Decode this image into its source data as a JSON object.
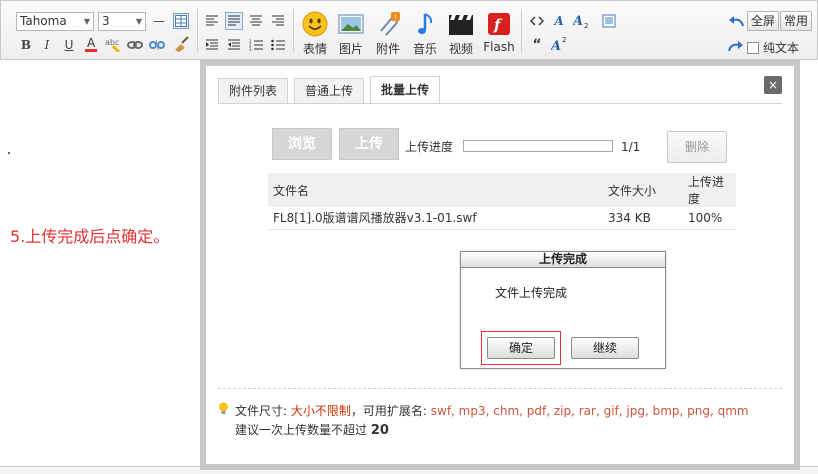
{
  "toolbar": {
    "font_family": "Tahoma",
    "font_size": "3",
    "big_tools": {
      "emoticon": "表情",
      "image": "图片",
      "attachment": "附件",
      "music": "音乐",
      "video": "视频",
      "flash": "Flash"
    },
    "fullscreen_label": "全屏",
    "common_label": "常用",
    "plain_text_label": "纯文本"
  },
  "editor": {
    "instruction": "5.上传完成后点确定。"
  },
  "dialog": {
    "tabs": [
      "附件列表",
      "普通上传",
      "批量上传"
    ],
    "active_tab": "批量上传",
    "close_label": "×",
    "browse_label": "浏览",
    "upload_label": "上传",
    "progress_label": "上传进度",
    "progress_fraction": 0,
    "progress_count": "1/1",
    "delete_label": "删除",
    "table": {
      "headers": [
        "文件名",
        "文件大小",
        "上传进度"
      ],
      "rows": [
        [
          "FL8[1].0版谱谱风播放器v3.1-01.swf",
          "334 KB",
          "100%"
        ]
      ]
    },
    "hint": {
      "size_prefix": "文件尺寸:",
      "size_value": "大小不限制",
      "ext_prefix": "，可用扩展名:",
      "ext_value": "swf, mp3, chm, pdf, zip, rar, gif, jpg, bmp, png, qmm",
      "count_prefix": "建议一次上传数量不超过",
      "count_value": "20"
    }
  },
  "modal": {
    "title": "上传完成",
    "message": "文件上传完成",
    "ok_label": "确定",
    "continue_label": "继续"
  },
  "colors": {
    "instruction_red": "#e03030",
    "highlight_red": "#e03030"
  }
}
